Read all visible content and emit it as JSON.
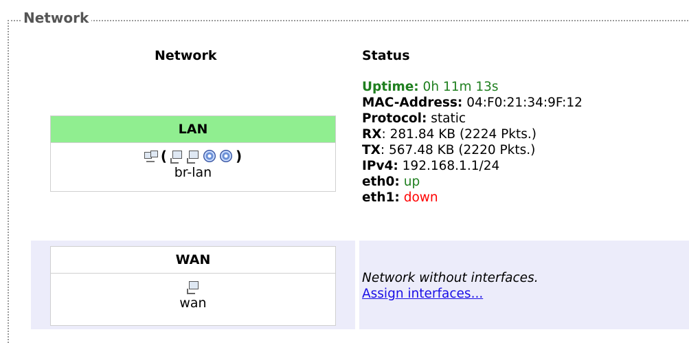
{
  "section": {
    "legend": "Network"
  },
  "columns": {
    "network": "Network",
    "status": "Status"
  },
  "lan": {
    "name": "LAN",
    "header_color": "#90ee90",
    "paren_open": "(",
    "paren_close": ")",
    "ifname": "br-lan",
    "status": {
      "uptime_label": "Uptime:",
      "uptime_value": " 0h 11m 13s",
      "mac_label": "MAC-Address:",
      "mac_value": " 04:F0:21:34:9F:12",
      "protocol_label": "Protocol:",
      "protocol_value": " static",
      "rx_label": "RX",
      "rx_value": ": 281.84 KB (2224 Pkts.)",
      "tx_label": "TX",
      "tx_value": ": 567.48 KB (2220 Pkts.)",
      "ipv4_label": "IPv4:",
      "ipv4_value": " 192.168.1.1/24",
      "eth0_label": "eth0:",
      "eth0_value": " up",
      "eth1_label": "eth1:",
      "eth1_value": " down"
    }
  },
  "wan": {
    "name": "WAN",
    "ifname": "wan",
    "status_text": "Network without interfaces.",
    "assign_link": "Assign interfaces..."
  }
}
